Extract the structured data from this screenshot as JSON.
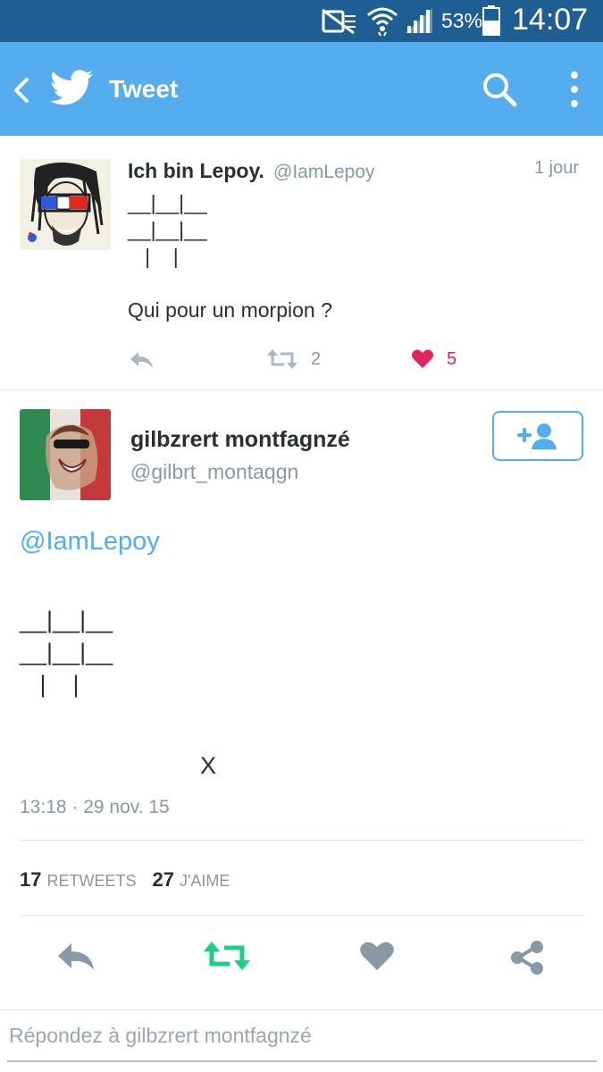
{
  "status_bar": {
    "battery_pct": "53%",
    "time": "14:07"
  },
  "app_bar": {
    "title": "Tweet"
  },
  "tweet1": {
    "name": "Ich bin Lepoy.",
    "handle": "@IamLepoy",
    "time": "1 jour",
    "body": "__|__|__\n__|__|__\n   |    |\n\nQui pour un morpion ?",
    "retweets": "2",
    "likes": "5"
  },
  "tweet2": {
    "name": "gilbzrert montfagnzé",
    "handle": "@gilbrt_montaqgn",
    "mention": "@IamLepoy",
    "board": "__|__|__\n__|__|__\n   |    |",
    "mark": "X",
    "timestamp": "13:18 · 29 nov. 15",
    "retweet_count": "17",
    "retweet_label": "RETWEETS",
    "like_count": "27",
    "like_label": "J'AIME"
  },
  "reply": {
    "placeholder": "Répondez à gilbzrert montfagnzé"
  },
  "colors": {
    "status_bar": "#1f5e93",
    "app_bar": "#55acee",
    "retweet_green": "#19cf86",
    "like_red": "#e0245e",
    "gray": "#8899a6"
  },
  "icons": [
    "mute-icon",
    "wifi-icon",
    "signal-icon",
    "battery-icon",
    "back-arrow-icon",
    "twitter-bird-icon",
    "search-icon",
    "overflow-menu-icon",
    "reply-icon",
    "retweet-icon",
    "heart-icon",
    "share-icon",
    "follow-icon"
  ]
}
